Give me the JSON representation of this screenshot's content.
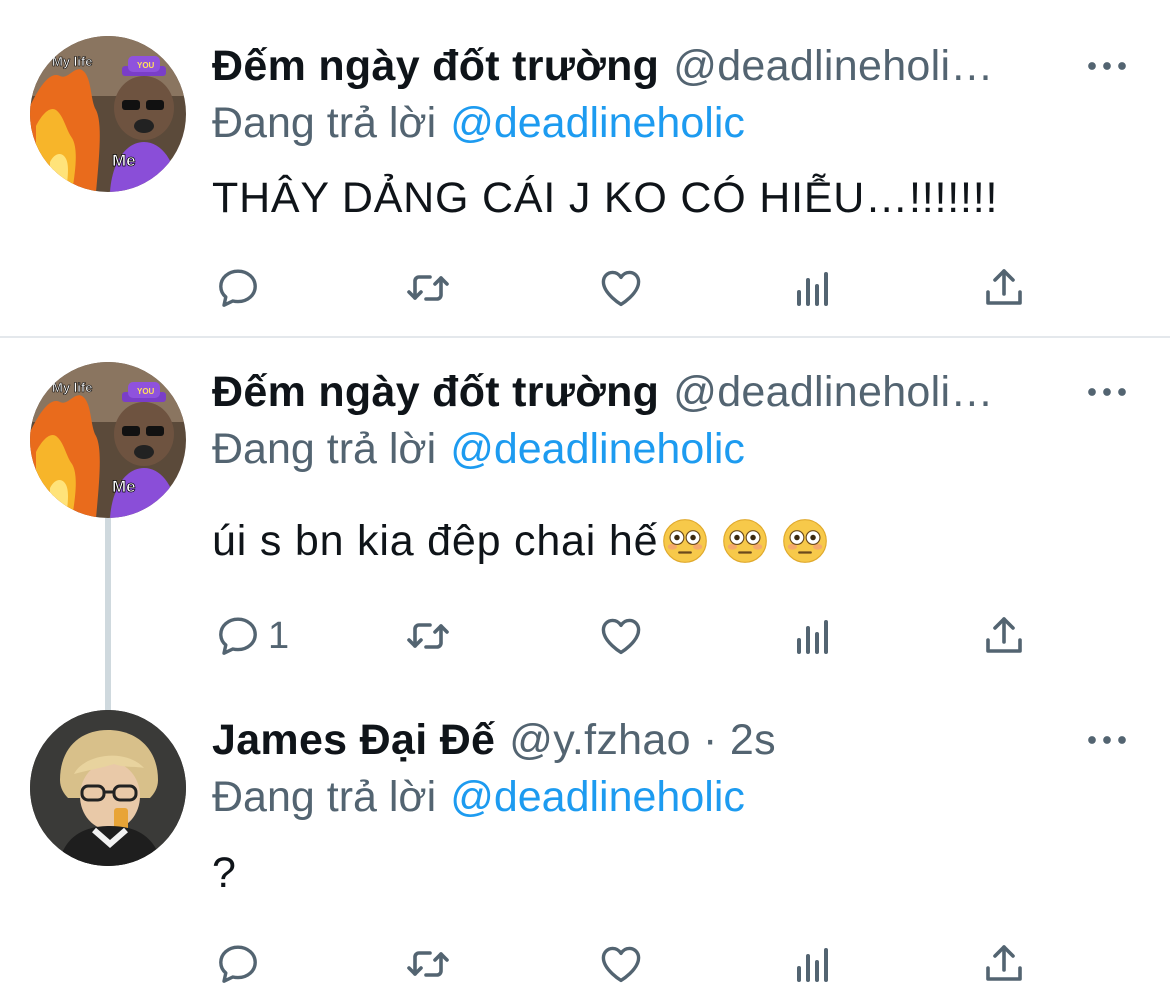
{
  "tweets": [
    {
      "display_name": "Đếm ngày đốt trường",
      "handle": "@deadlineholi…",
      "replying_label": "Đang trả lời",
      "replying_to": "@deadlineholic",
      "text": "THÂY DẢNG CÁI J KO CÓ HIỄU…!!!!!!!",
      "avatar": {
        "top_label": "My life",
        "bottom_label": "Me",
        "badge": "YOU"
      },
      "reply_count": ""
    },
    {
      "display_name": "Đếm ngày đốt trường",
      "handle": "@deadlineholi…",
      "replying_label": "Đang trả lời",
      "replying_to": "@deadlineholic",
      "text": "úi s bn kia đêp chai hế",
      "emojis": [
        "flushed-face",
        "flushed-face",
        "flushed-face"
      ],
      "avatar": {
        "top_label": "My life",
        "bottom_label": "Me",
        "badge": "YOU"
      },
      "reply_count": "1"
    },
    {
      "display_name": "James Đại Đế",
      "handle": "@y.fzhao · 2s",
      "replying_label": "Đang trả lời",
      "replying_to": "@deadlineholic",
      "text": "?",
      "reply_count": ""
    }
  ],
  "icons": [
    "more-icon",
    "reply-icon",
    "retweet-icon",
    "like-icon",
    "analytics-icon",
    "share-icon"
  ],
  "colors": {
    "mention": "#1d9bf0",
    "secondary_text": "#536471",
    "divider": "#e4e8ec",
    "thread_line": "#cfd9de"
  }
}
